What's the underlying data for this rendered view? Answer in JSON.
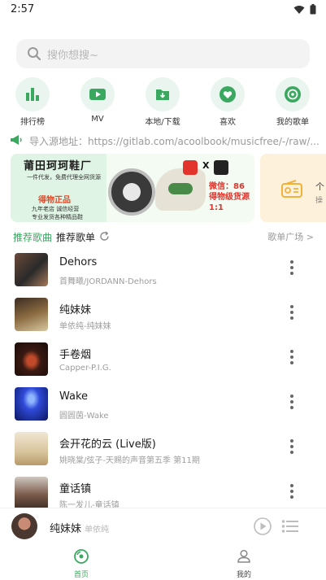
{
  "status_bar": {
    "time": "2:57"
  },
  "search": {
    "placeholder": "搜你想搜~"
  },
  "quick_nav": [
    {
      "label": "排行榜",
      "icon": "chart-bars-icon"
    },
    {
      "label": "MV",
      "icon": "video-icon"
    },
    {
      "label": "本地/下载",
      "icon": "folder-download-icon"
    },
    {
      "label": "喜欢",
      "icon": "heart-icon"
    },
    {
      "label": "我的歌单",
      "icon": "disc-icon"
    }
  ],
  "notice": {
    "text": "导入源地址：https://gitlab.com/acoolbook/musicfree/-/raw/..."
  },
  "banner": {
    "title": "莆田珂珂鞋厂",
    "tag": "得物正品",
    "line1": "一件代发，免费代理全网货源",
    "line2": "九年老店 诚信经营",
    "line3": "专业发货各种精品鞋",
    "right_text": "微信：86 得物级货源1:1",
    "x": "X"
  },
  "banner2": {
    "text1": "个",
    "text2": "操"
  },
  "tabs": {
    "recommend_songs": "推荐歌曲",
    "recommend_playlists": "推荐歌单",
    "more": "歌单广场 >"
  },
  "songs": [
    {
      "title": "Dehors",
      "subtitle": "首舞曦/JORDANN-Dehors"
    },
    {
      "title": "纯妹妹",
      "subtitle": "单依纯-纯妹妹"
    },
    {
      "title": "手卷烟",
      "subtitle": "Capper-P.I.G."
    },
    {
      "title": "Wake",
      "subtitle": "圆圆茵-Wake"
    },
    {
      "title": "会开花的云 (Live版)",
      "subtitle": "姚晓棠/弦子-天赐的声音第五季 第11期"
    },
    {
      "title": "童话镇",
      "subtitle": "陈一发儿-童话镇"
    }
  ],
  "player": {
    "title": "纯妹妹",
    "artist": "单依纯"
  },
  "bottom_nav": [
    {
      "label": "首页",
      "icon": "home-disc-icon",
      "active": true
    },
    {
      "label": "我的",
      "icon": "person-icon",
      "active": false
    }
  ],
  "colors": {
    "accent": "#3aa85f",
    "tint": "#e9f5ee"
  }
}
